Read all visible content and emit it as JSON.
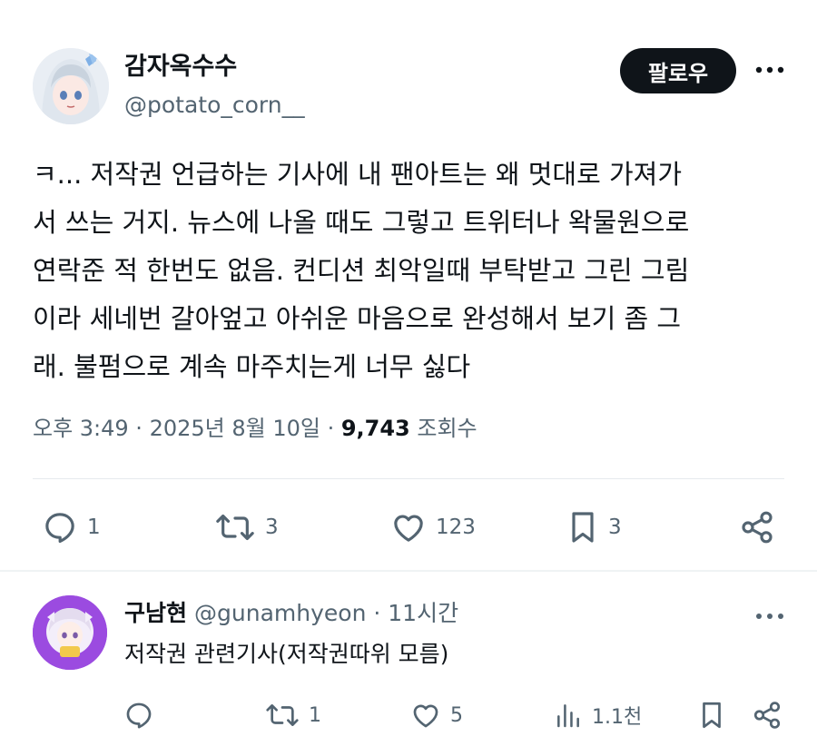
{
  "post": {
    "author": {
      "display_name": "감자옥수수",
      "handle": "@potato_corn__"
    },
    "follow_label": "팔로우",
    "text": "ㅋ... 저작권 언급하는 기사에 내 팬아트는 왜 멋대로 가져가\n서 쓰는 거지. 뉴스에 나올 때도 그렇고 트위터나 왁물원으로\n연락준 적 한번도 없음. 컨디션 최악일때 부탁받고 그린 그림\n이라 세네번 갈아엎고 아쉬운 마음으로 완성해서 보기 좀 그\n래. 불펌으로 계속 마주치는게 너무 싫다",
    "timestamp": "오후 3:49 · 2025년 8월 10일 · ",
    "views_count": "9,743",
    "views_label": " 조회수",
    "actions": {
      "replies": "1",
      "reposts": "3",
      "likes": "123",
      "bookmarks": "3"
    },
    "icons": [
      "reply-icon",
      "repost-icon",
      "like-icon",
      "bookmark-icon",
      "share-icon",
      "more-icon"
    ]
  },
  "reply": {
    "author": {
      "display_name": "구남현",
      "handle": "@gunamhyeon",
      "time": " · 11시간"
    },
    "text": "저작권 관련기사(저작권따위 모름)",
    "actions": {
      "replies": "",
      "reposts": "1",
      "likes": "5",
      "views": "1.1천"
    }
  },
  "colors": {
    "text": "#0f1419",
    "secondary": "#536471",
    "follow_bg": "#0f1419",
    "reply_avatar": "#9b4be0"
  }
}
